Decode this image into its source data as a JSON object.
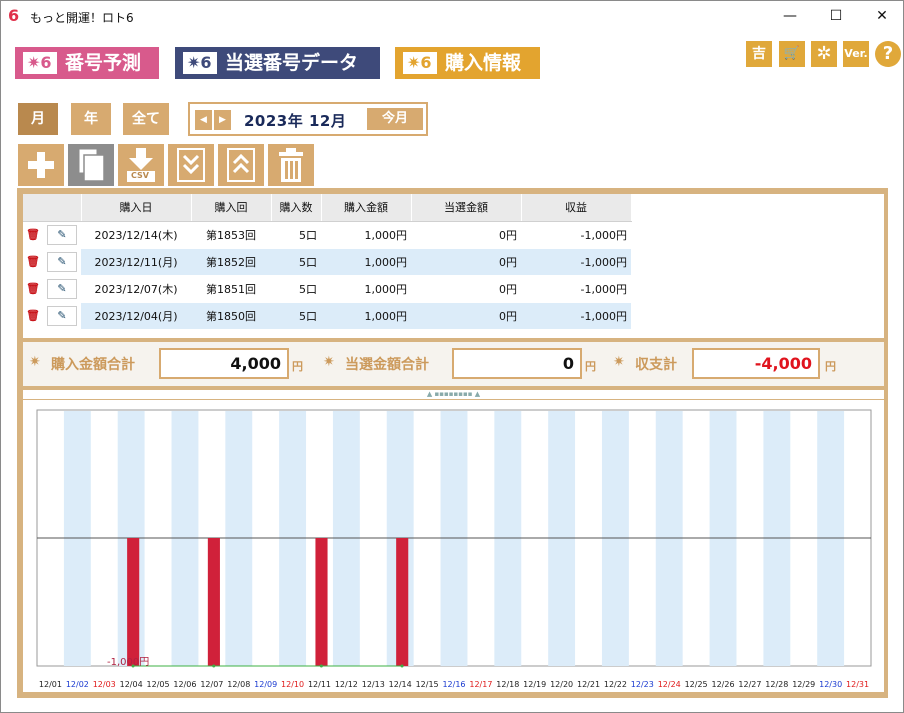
{
  "window": {
    "title": "もっと開運！ロト6",
    "logo": "6",
    "minimize": "—",
    "maximize": "☐",
    "close": "✕"
  },
  "header_tabs": [
    {
      "badge": "✷6",
      "label": "番号予測",
      "color": "#d85a8c"
    },
    {
      "badge": "✷6",
      "label": "当選番号データ",
      "color": "#3e4a7a"
    },
    {
      "badge": "✷6",
      "label": "購入情報",
      "color": "#e3a42f"
    }
  ],
  "top_icons": [
    {
      "name": "fortune-icon",
      "glyph": "吉"
    },
    {
      "name": "cart-icon",
      "glyph": "🛒"
    },
    {
      "name": "gear-icon",
      "glyph": "✲"
    },
    {
      "name": "version-icon",
      "glyph": "Ver."
    },
    {
      "name": "help-icon",
      "glyph": "?"
    }
  ],
  "period_buttons": {
    "month": "月",
    "year": "年",
    "all": "全て"
  },
  "date_nav": {
    "prev": "◀",
    "next": "▶",
    "current": "2023年 12月",
    "today": "今月"
  },
  "action_buttons": [
    "add",
    "copy",
    "csv",
    "expand",
    "collapse",
    "delete"
  ],
  "action_labels": {
    "csv": "CSV"
  },
  "table": {
    "columns": [
      "購入日",
      "購入回",
      "購入数",
      "購入金額",
      "当選金額",
      "収益"
    ],
    "rows": [
      [
        "2023/12/14(木)",
        "第1853回",
        "5口",
        "1,000円",
        "0円",
        "-1,000円"
      ],
      [
        "2023/12/11(月)",
        "第1852回",
        "5口",
        "1,000円",
        "0円",
        "-1,000円"
      ],
      [
        "2023/12/07(木)",
        "第1851回",
        "5口",
        "1,000円",
        "0円",
        "-1,000円"
      ],
      [
        "2023/12/04(月)",
        "第1850回",
        "5口",
        "1,000円",
        "0円",
        "-1,000円"
      ]
    ]
  },
  "summary": {
    "purchase_label": "購入金額合計",
    "purchase_value": "4,000",
    "win_label": "当選金額合計",
    "win_value": "0",
    "balance_label": "収支計",
    "balance_value": "-4,000",
    "yen": "円",
    "balance_color": "#e0141e"
  },
  "chart_data": {
    "type": "bar",
    "categories": [
      "12/01",
      "12/02",
      "12/03",
      "12/04",
      "12/05",
      "12/06",
      "12/07",
      "12/08",
      "12/09",
      "12/10",
      "12/11",
      "12/12",
      "12/13",
      "12/14",
      "12/15",
      "12/16",
      "12/17",
      "12/18",
      "12/19",
      "12/20",
      "12/21",
      "12/22",
      "12/23",
      "12/24",
      "12/25",
      "12/26",
      "12/27",
      "12/28",
      "12/29",
      "12/30",
      "12/31"
    ],
    "values": [
      0,
      0,
      0,
      -1000,
      0,
      0,
      -1000,
      0,
      0,
      0,
      -1000,
      0,
      0,
      -1000,
      0,
      0,
      0,
      0,
      0,
      0,
      0,
      0,
      0,
      0,
      0,
      0,
      0,
      0,
      0,
      0,
      0
    ],
    "min_label": "-1,000円",
    "ylim": [
      -1000,
      1000
    ],
    "bar_color": "#d0213a",
    "saturdays": [
      "12/02",
      "12/09",
      "12/16",
      "12/23",
      "12/30"
    ],
    "sundays": [
      "12/03",
      "12/10",
      "12/17",
      "12/24",
      "12/31"
    ],
    "saturday_color": "#1a3ad0",
    "sunday_color": "#e01a1a",
    "stripe_color": "#dcecf9"
  }
}
